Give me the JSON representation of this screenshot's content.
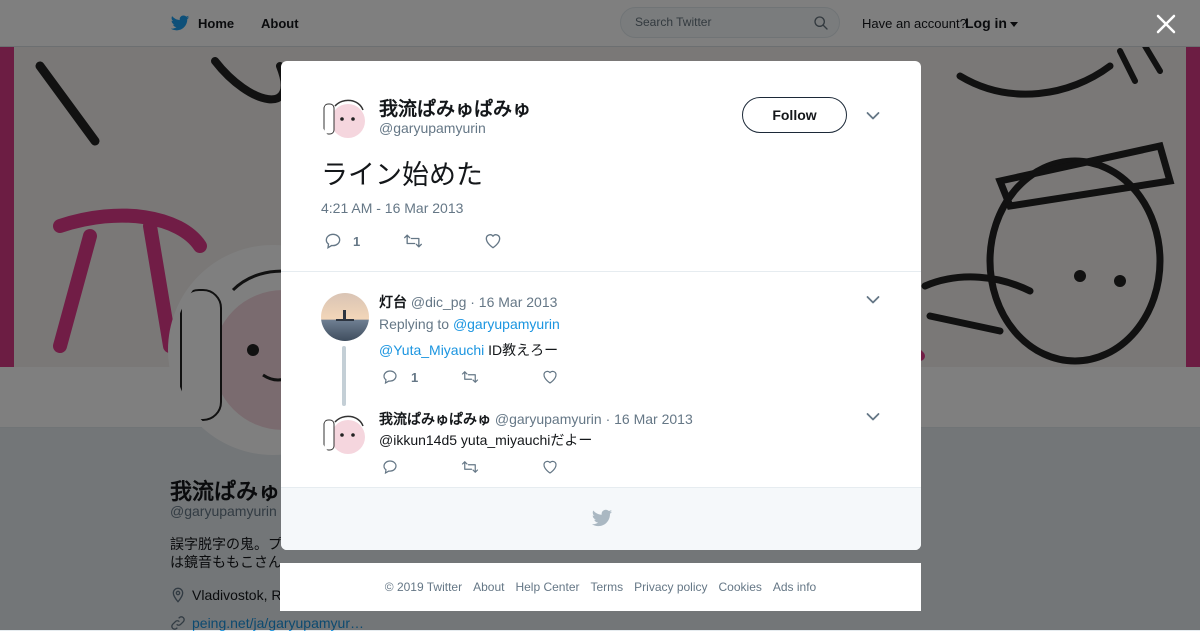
{
  "topbar": {
    "home_label": "Home",
    "about_label": "About",
    "search_placeholder": "Search Twitter",
    "have_account": "Have an account?",
    "login_label": "Log in"
  },
  "profile": {
    "name": "我流ぱみゅぱみゅ",
    "handle": "@garyupamyurin",
    "bio": "誤字脱字の鬼。プ",
    "bio_line2": "は鏡音ももこさん",
    "location": "Vladivostok, R",
    "link": "peing.net/ja/garyupamyur…"
  },
  "tweet": {
    "author_name": "我流ぱみゅぱみゅ",
    "author_handle": "@garyupamyurin",
    "follow_label": "Follow",
    "text": "ライン始めた",
    "timestamp": "4:21 AM - 16 Mar 2013",
    "reply_count": "1",
    "retweet_count": "",
    "like_count": ""
  },
  "replies": [
    {
      "name": "灯台",
      "handle": "@dic_pg",
      "date": "· 16 Mar 2013",
      "replying_prefix": "Replying to",
      "replying_to": "@garyupamyurin",
      "mention": "@Yuta_Miyauchi",
      "text": " ID教えろー",
      "reply_count": "1"
    },
    {
      "name": "我流ぱみゅぱみゅ",
      "handle": "@garyupamyurin",
      "date": "· 16 Mar 2013",
      "text": "@ikkun14d5 yuta_miyauchiだよー",
      "reply_count": ""
    }
  ],
  "footer": {
    "copyright": "© 2019 Twitter",
    "links": [
      "About",
      "Help Center",
      "Terms",
      "Privacy policy",
      "Cookies",
      "Ads info"
    ]
  },
  "colors": {
    "brand_blue": "#1da1f2",
    "link_blue": "#1b95e0",
    "banner_pink": "#d83a86",
    "text_dark": "#14171a",
    "text_gray": "#657786"
  },
  "icons": {
    "logo": "twitter-bird-icon",
    "search": "search-icon",
    "close": "close-icon",
    "reply": "reply-icon",
    "retweet": "retweet-icon",
    "like": "heart-icon",
    "more": "chevron-down-icon",
    "location": "location-pin-icon",
    "link": "link-icon"
  }
}
